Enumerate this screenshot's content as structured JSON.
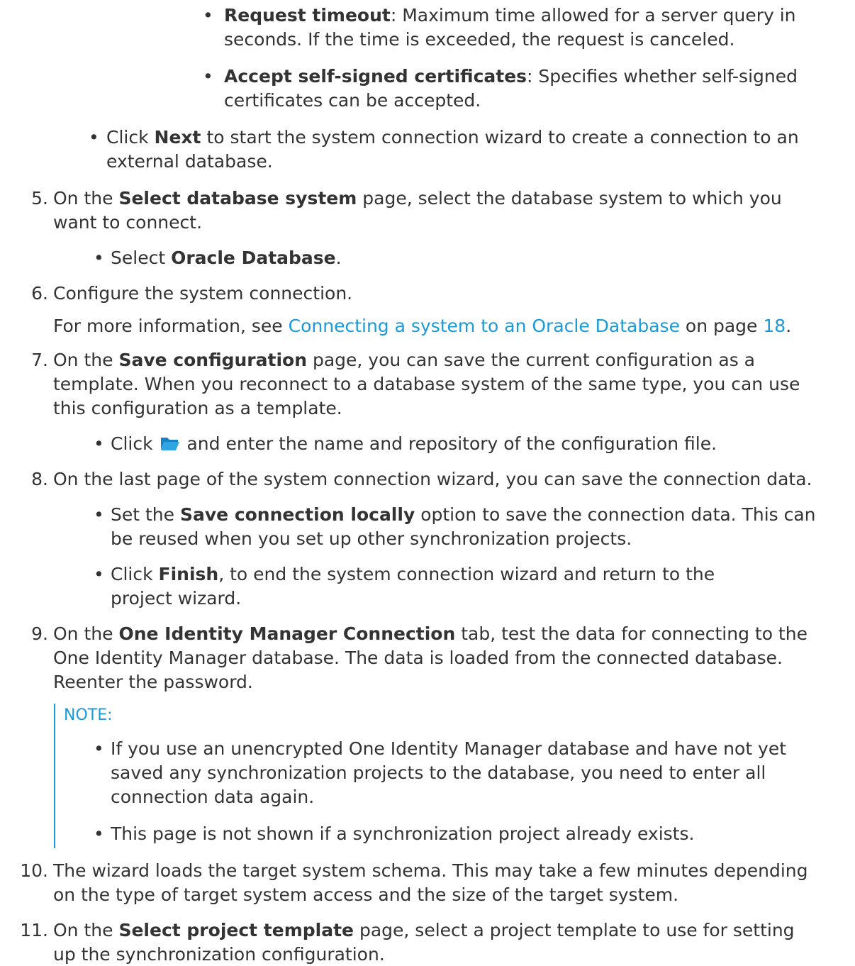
{
  "sub_bullets": [
    {
      "bold": "Request timeout",
      "rest": ": Maximum time allowed for a server query in",
      "line2": "seconds. If the time is exceeded, the request is canceled."
    },
    {
      "bold": "Accept self-signed certificates",
      "rest": ": Specifies whether self-signed",
      "line2": "certificates can be accepted."
    }
  ],
  "bullet_next": {
    "pre": "Click ",
    "bold": "Next",
    "rest": " to start the system connection wizard to create a connection to an",
    "line2": "external database."
  },
  "steps": {
    "s5": {
      "num": "5.",
      "pre": "On the ",
      "bold": "Select database system",
      "rest": " page, select the database system to which you",
      "line2": "want to connect.",
      "bullet": {
        "pre": "Select ",
        "bold": "Oracle Database",
        "rest": "."
      }
    },
    "s6": {
      "num": "6.",
      "text": "Configure the system connection.",
      "more_pre": "For more information, see ",
      "more_link": "Connecting a system to an Oracle Database",
      "more_mid": " on page ",
      "more_page": "18",
      "more_end": "."
    },
    "s7": {
      "num": "7.",
      "pre": "On the ",
      "bold": "Save configuration",
      "rest": " page, you can save the current configuration as a",
      "line2": "template. When you reconnect to a database system of the same type, you can use",
      "line3": "this configuration as a template.",
      "bullet": {
        "pre": "Click ",
        "icon": "folder-open-icon",
        "rest": " and enter the name and repository of the configuration file."
      }
    },
    "s8": {
      "num": "8.",
      "text": "On the last page of the system connection wizard, you can save the connection data.",
      "bullet1": {
        "pre": "Set the ",
        "bold": "Save connection locally",
        "rest": " option to save the connection data. This can",
        "line2": "be reused when you set up other synchronization projects."
      },
      "bullet2": {
        "pre": "Click ",
        "bold": "Finish",
        "rest": ", to end the system connection wizard and return to the",
        "line2": "project wizard."
      }
    },
    "s9": {
      "num": "9.",
      "pre": "On the ",
      "bold": "One Identity Manager Connection",
      "rest": " tab, test the data for connecting to the",
      "line2": "One Identity Manager database. The data is loaded from the connected database.",
      "line3": "Reenter the password.",
      "note_label": "NOTE:",
      "note_b1_l1": "If you use an unencrypted One Identity Manager database and have not yet",
      "note_b1_l2": "saved any synchronization projects to the database, you need to enter all",
      "note_b1_l3": "connection data again.",
      "note_b2": "This page is not shown if a synchronization project already exists."
    },
    "s10": {
      "num": "10.",
      "line1": "The wizard loads the target system schema. This may take a few minutes depending",
      "line2": "on the type of target system access and the size of the target system."
    },
    "s11": {
      "num": "11.",
      "pre": "On the ",
      "bold": "Select project template",
      "rest": " page, select a project template to use for setting",
      "line2": "up the synchronization configuration."
    }
  },
  "colors": {
    "text": "#333333",
    "link": "#1a9ad6",
    "icon": "#1a9ad6"
  }
}
